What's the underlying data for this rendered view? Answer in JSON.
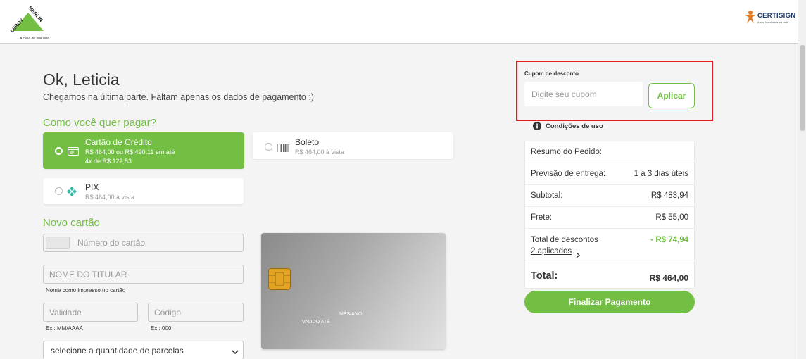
{
  "header": {
    "logo_text": "LEROY MERLIN",
    "logo_tagline": "A casa de sua vida",
    "partner_name": "CERTISIGN",
    "partner_tagline": "A sua identidade na rede"
  },
  "page": {
    "greeting": "Ok, Leticia",
    "subtitle": "Chegamos na última parte. Faltam apenas os dados de pagamento :)"
  },
  "payment": {
    "section_title": "Como você quer pagar?",
    "methods": [
      {
        "name": "Cartão de Crédito",
        "line1": "R$ 464,00 ou R$ 490,11 em até",
        "line2": "4x de R$ 122,53",
        "selected": true
      },
      {
        "name": "Boleto",
        "line1": "R$ 464,00 à vista",
        "selected": false
      },
      {
        "name": "PIX",
        "line1": "R$ 464,00 à vista",
        "selected": false
      }
    ]
  },
  "new_card": {
    "section_title": "Novo cartão",
    "card_number_placeholder": "Número do cartão",
    "holder_placeholder": "NOME DO TITULAR",
    "holder_hint": "Nome como impresso no cartão",
    "validity_placeholder": "Validade",
    "validity_hint": "Ex.: MM/AAAA",
    "code_placeholder": "Código",
    "code_hint": "Ex.: 000",
    "installments_selected": "selecione a quantidade de parcelas",
    "card_preview": {
      "month_year": "MÊS/ANO",
      "valid_until": "VALIDO ATÉ"
    }
  },
  "coupon": {
    "label": "Cupom de desconto",
    "placeholder": "Digite seu cupom",
    "apply_label": "Aplicar",
    "terms_label": "Condições de uso"
  },
  "summary": {
    "title": "Resumo do Pedido:",
    "delivery_label": "Previsão de entrega:",
    "delivery_value": "1 a 3 dias úteis",
    "subtotal_label": "Subtotal:",
    "subtotal_value": "R$ 483,94",
    "shipping_label": "Frete:",
    "shipping_value": "R$ 55,00",
    "discounts_label": "Total de descontos",
    "discounts_value": "- R$ 74,94",
    "discounts_applied": "2 aplicados",
    "total_label": "Total:",
    "total_value": "R$ 464,00",
    "finish_label": "Finalizar Pagamento"
  },
  "colors": {
    "accent": "#72bf44",
    "highlight": "#e31e24"
  }
}
